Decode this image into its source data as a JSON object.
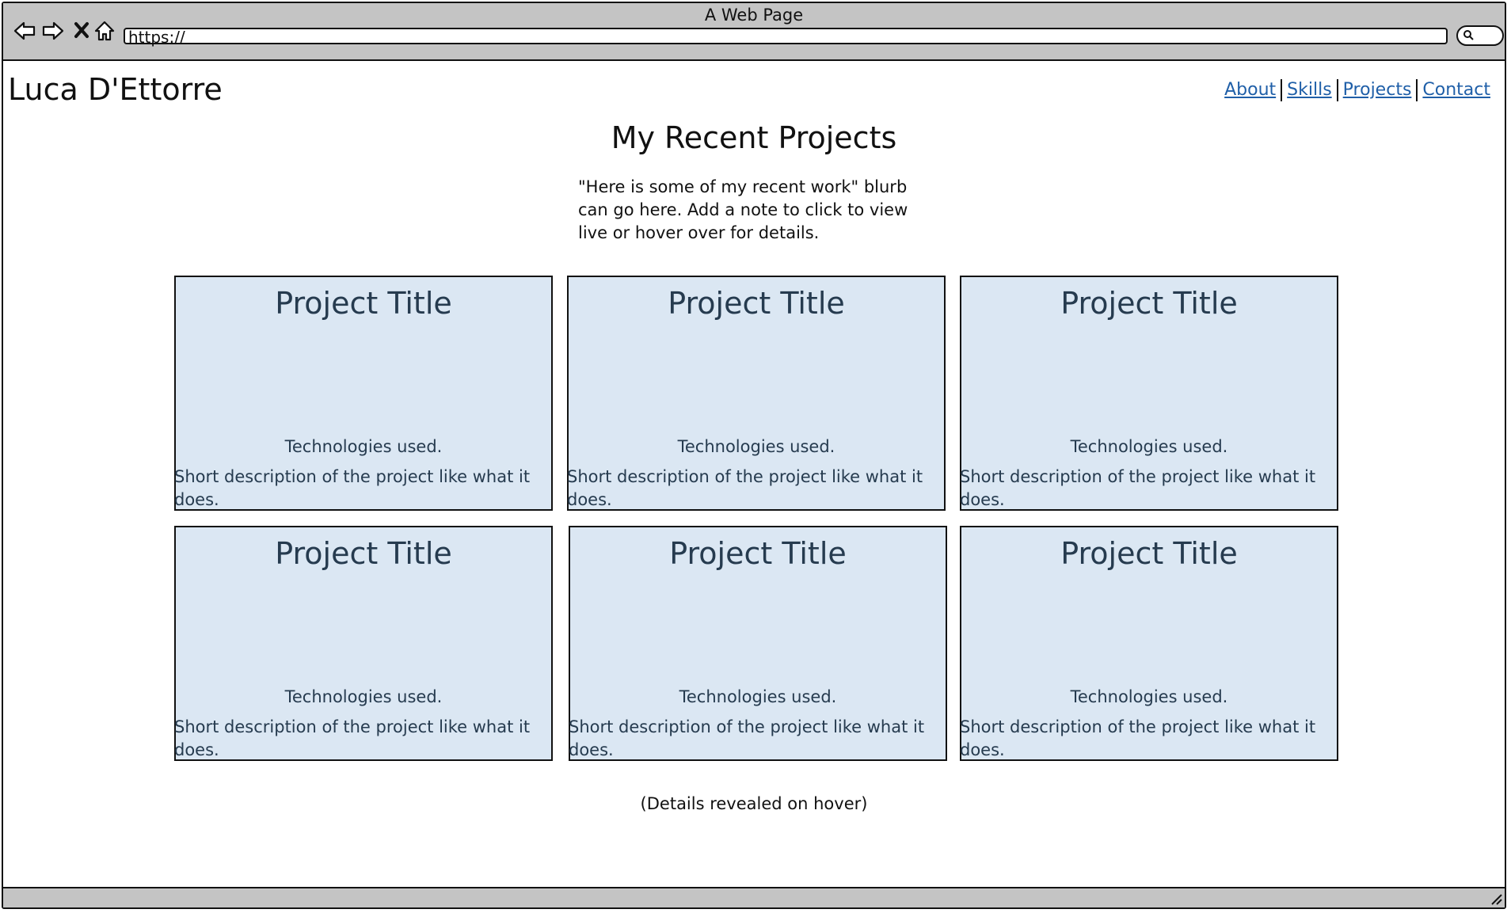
{
  "browser": {
    "window_title": "A Web Page",
    "url": "https://"
  },
  "header": {
    "site_name": "Luca D'Ettorre",
    "nav": [
      "About",
      "Skills",
      "Projects",
      "Contact"
    ]
  },
  "main": {
    "heading": "My Recent Projects",
    "blurb": "\"Here is some of my recent work\" blurb can go here. Add a note to click to view live or hover over for details.",
    "projects": [
      {
        "title": "Project Title",
        "tech": "Technologies used.",
        "description": "Short description of the project like what it does."
      },
      {
        "title": "Project Title",
        "tech": "Technologies used.",
        "description": "Short description of the project like what it does."
      },
      {
        "title": "Project Title",
        "tech": "Technologies used.",
        "description": "Short description of the project like what it does."
      },
      {
        "title": "Project Title",
        "tech": "Technologies used.",
        "description": "Short description of the project like what it does."
      },
      {
        "title": "Project Title",
        "tech": "Technologies used.",
        "description": "Short description of the project like what it does."
      },
      {
        "title": "Project Title",
        "tech": "Technologies used.",
        "description": "Short description of the project like what it does."
      }
    ],
    "hover_note": "(Details revealed on hover)"
  },
  "icons": [
    "back-arrow-icon",
    "forward-arrow-icon",
    "stop-icon",
    "home-icon",
    "search-icon",
    "resize-grip-icon"
  ],
  "colors": {
    "chrome": "#c4c4c4",
    "card_fill": "#dbe7f3",
    "card_text": "#263b4f",
    "link": "#1f5fa8"
  }
}
